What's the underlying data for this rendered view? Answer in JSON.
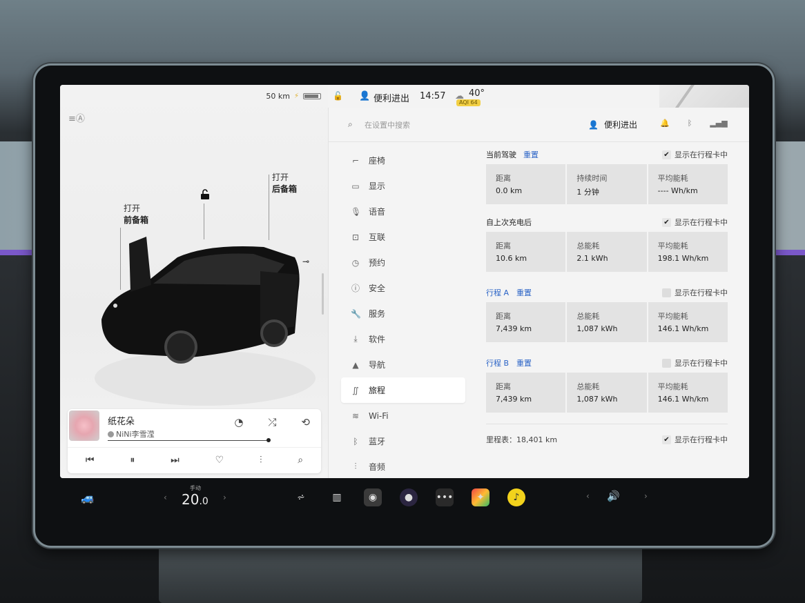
{
  "status": {
    "range": "50 km",
    "time": "14:57",
    "temp": "40°",
    "aqi_badge": "AQI 64",
    "profile_name": "便利进出"
  },
  "car": {
    "frunk_action": "打开",
    "frunk_label": "前备箱",
    "trunk_action": "打开",
    "trunk_label": "后备箱"
  },
  "media": {
    "song": "纸花朵",
    "artist": "NiNi李雪滢",
    "progress": 0.93
  },
  "search": {
    "placeholder": "在设置中搜索"
  },
  "header_profile": "便利进出",
  "nav": {
    "items": [
      {
        "label": "座椅",
        "icon": "seat-icon"
      },
      {
        "label": "显示",
        "icon": "display-icon"
      },
      {
        "label": "语音",
        "icon": "microphone-icon"
      },
      {
        "label": "互联",
        "icon": "connectivity-icon"
      },
      {
        "label": "预约",
        "icon": "schedule-icon"
      },
      {
        "label": "安全",
        "icon": "safety-icon"
      },
      {
        "label": "服务",
        "icon": "wrench-icon"
      },
      {
        "label": "软件",
        "icon": "download-icon"
      },
      {
        "label": "导航",
        "icon": "navigation-icon"
      },
      {
        "label": "旅程",
        "icon": "trips-icon",
        "active": true
      },
      {
        "label": "Wi-Fi",
        "icon": "wifi-icon"
      },
      {
        "label": "蓝牙",
        "icon": "bluetooth-icon"
      },
      {
        "label": "音频",
        "icon": "audio-icon"
      }
    ]
  },
  "trips": {
    "show_on_card": "显示在行程卡中",
    "reset_label": "重置",
    "current": {
      "title": "当前驾驶",
      "checked": true,
      "stats": [
        {
          "label": "距离",
          "value": "0.0  km"
        },
        {
          "label": "持续时间",
          "value": "1 分钟"
        },
        {
          "label": "平均能耗",
          "value": "----  Wh/km"
        }
      ]
    },
    "since_charge": {
      "title": "自上次充电后",
      "checked": true,
      "stats": [
        {
          "label": "距离",
          "value": "10.6  km"
        },
        {
          "label": "总能耗",
          "value": "2.1 kWh"
        },
        {
          "label": "平均能耗",
          "value": "198.1  Wh/km"
        }
      ]
    },
    "trip_a": {
      "title": "行程 A",
      "checked": false,
      "stats": [
        {
          "label": "距离",
          "value": "7,439  km"
        },
        {
          "label": "总能耗",
          "value": "1,087 kWh"
        },
        {
          "label": "平均能耗",
          "value": "146.1  Wh/km"
        }
      ]
    },
    "trip_b": {
      "title": "行程 B",
      "checked": false,
      "stats": [
        {
          "label": "距离",
          "value": "7,439  km"
        },
        {
          "label": "总能耗",
          "value": "1,087 kWh"
        },
        {
          "label": "平均能耗",
          "value": "146.1  Wh/km"
        }
      ]
    },
    "odometer": "里程表：18,401 km",
    "odometer_checked": true
  },
  "dock": {
    "temp_mode": "手动",
    "temp_int": "20",
    "temp_dec": ".0"
  }
}
